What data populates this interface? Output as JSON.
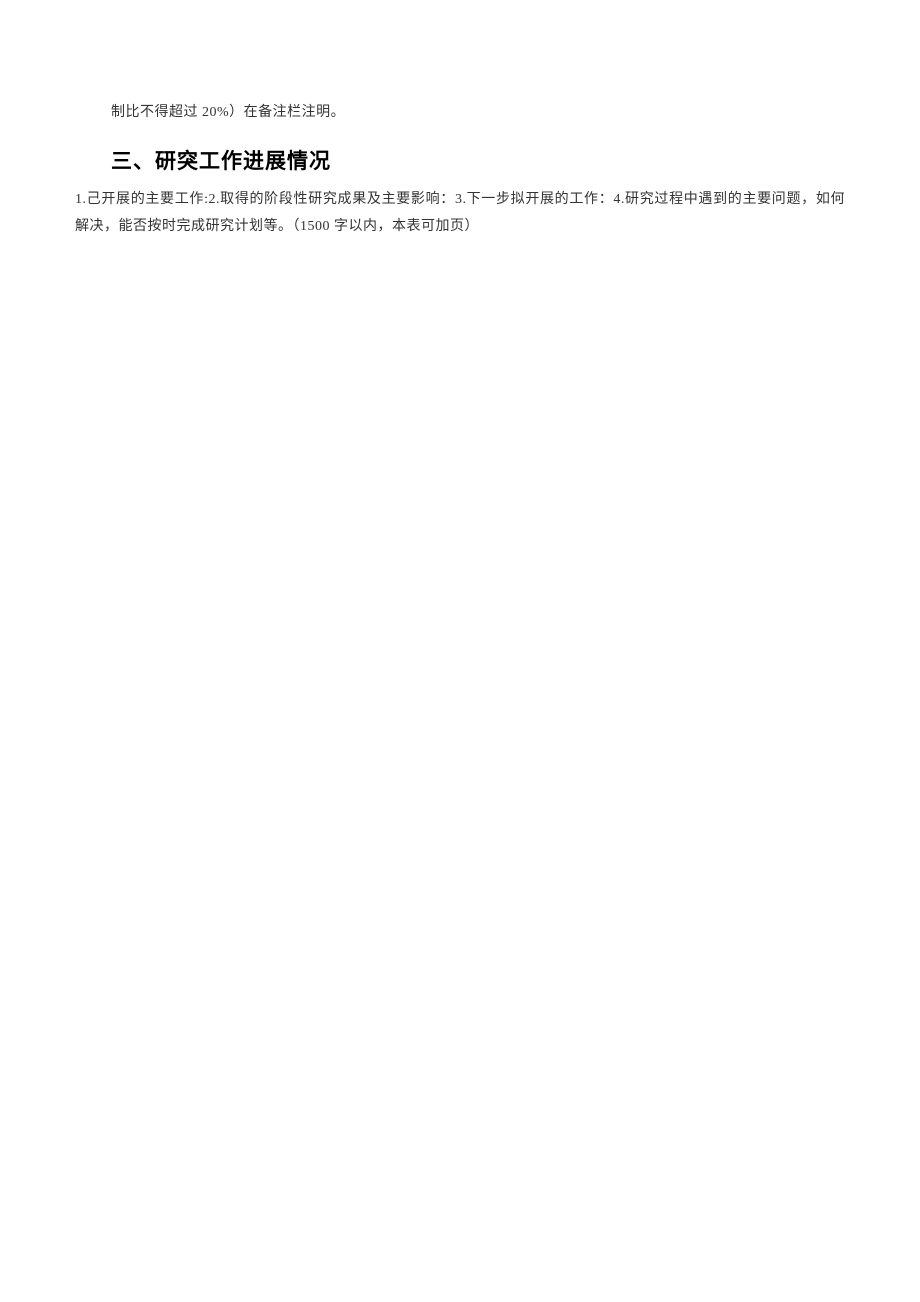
{
  "continuation": "制比不得超过 20%）在备注栏注明。",
  "heading": "三、研突工作进展情况",
  "body": "1.己开展的主要工作:2.取得的阶段性研究成果及主要影响：3.下一步拟开展的工作：4.研究过程中遇到的主要问题，如何解决，能否按时完成研究计划等。（1500 字以内，本表可加页）"
}
